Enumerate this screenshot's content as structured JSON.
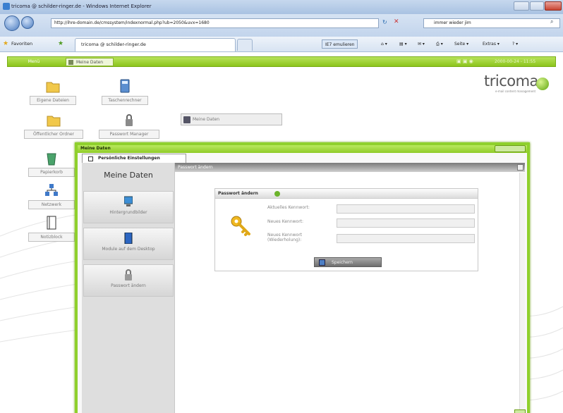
{
  "browser": {
    "window_title": "tricoma @ schilder-ringer.de - Windows Internet Explorer",
    "url": "http://ihre-domain.de/cmssystem/indexnormal.php?ub=2050&uvx=1680",
    "search_text": "immer wieder jim",
    "favorites_label": "Favoriten",
    "tab_label": "tricoma @ schilder-ringer.de",
    "compat_label": "IE7 emulieren",
    "page_label": "Seite",
    "extras_label": "Extras"
  },
  "app": {
    "menu_label": "Menü",
    "active_tab": "Meine Daten",
    "clock": "2000-00-24 - 11:55",
    "logo_text": "tricoma",
    "logo_sub": "e-mail content management"
  },
  "desktop": {
    "icons": [
      {
        "label": "Eigene Dateien",
        "icon": "folder-icon"
      },
      {
        "label": "Taschenrechner",
        "icon": "calculator-icon"
      },
      {
        "label": "Öffentlicher Ordner",
        "icon": "folder-icon"
      },
      {
        "label": "Passwort Manager",
        "icon": "lock-icon"
      },
      {
        "label": "Papierkorb",
        "icon": "recycle-bin-icon"
      },
      {
        "label": "Netzwerk",
        "icon": "network-icon"
      },
      {
        "label": "Notizblock",
        "icon": "notepad-icon"
      }
    ],
    "shortcut_label": "Meine Daten"
  },
  "dialog": {
    "title": "Meine Daten",
    "tab_label": "Persönliche Einstellungen",
    "side_title": "Meine Daten",
    "side_buttons": [
      {
        "label": "Hintergrundbilder",
        "icon": "monitor-icon"
      },
      {
        "label": "Module auf dem Desktop",
        "icon": "module-icon"
      },
      {
        "label": "Passwort ändern",
        "icon": "lock-icon"
      }
    ],
    "panel_title": "Passwort ändern",
    "form": {
      "title": "Passwort ändern",
      "fields": [
        {
          "label": "Aktuelles Kennwort:",
          "value": ""
        },
        {
          "label": "Neues Kennwort:",
          "value": ""
        },
        {
          "label": "Neues Kennwort (Wiederholung):",
          "value": ""
        }
      ],
      "save_label": "Speichern"
    }
  },
  "colors": {
    "accent": "#8fd02c",
    "ie_chrome": "#c2d4ec"
  }
}
